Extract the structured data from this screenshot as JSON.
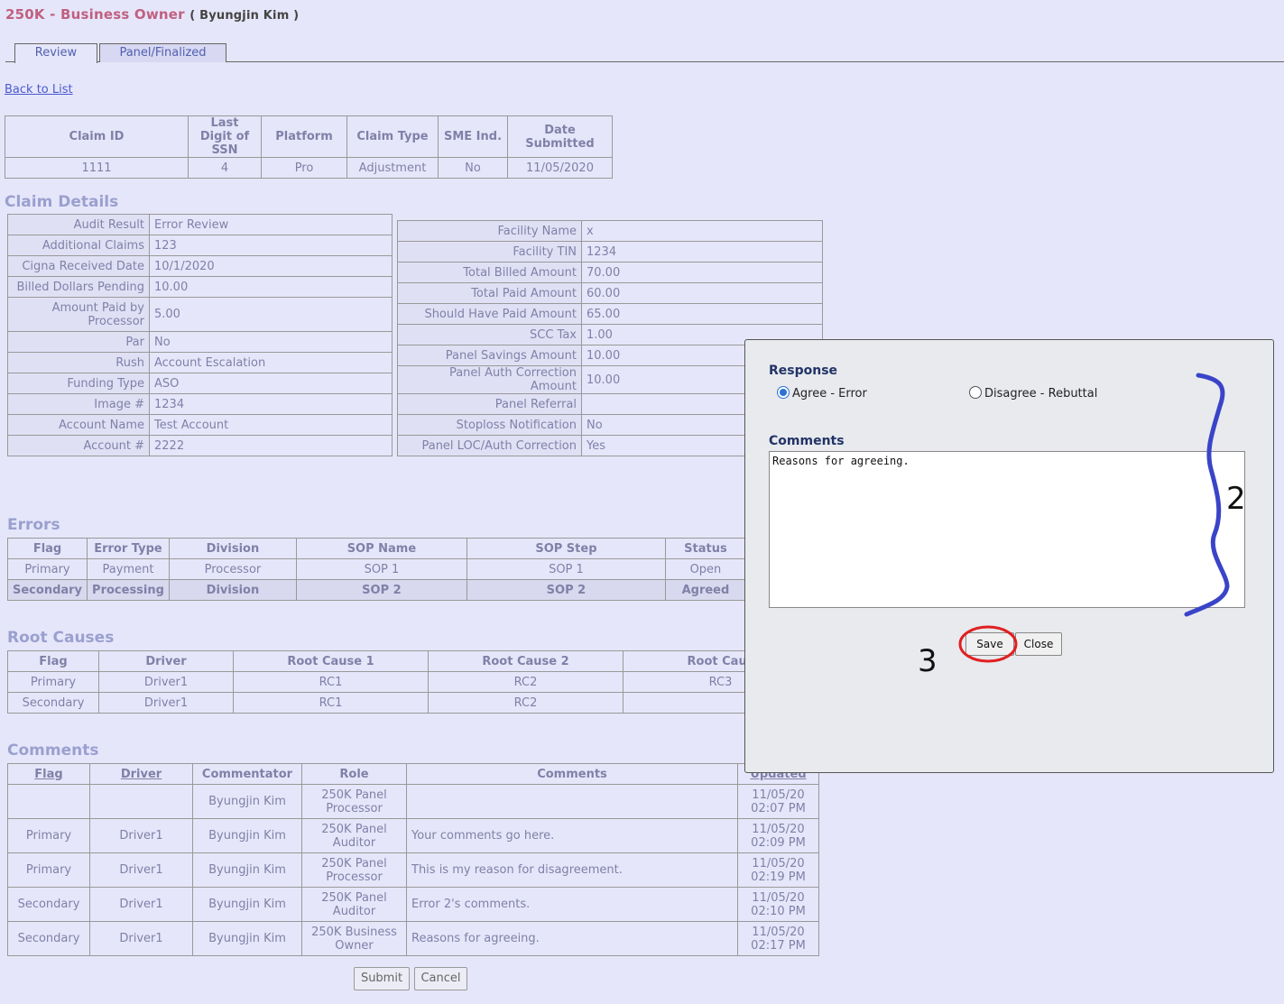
{
  "header": {
    "title": "250K - Business Owner",
    "user": "( Byungjin Kim )"
  },
  "tabs": [
    {
      "label": "Review"
    },
    {
      "label": "Panel/Finalized"
    }
  ],
  "back_link": "Back to List",
  "claim_summary": {
    "headers": [
      "Claim ID",
      "Last Digit of SSN",
      "Platform",
      "Claim Type",
      "SME Ind.",
      "Date Submitted"
    ],
    "values": [
      "1111",
      "4",
      "Pro",
      "Adjustment",
      "No",
      "11/05/2020"
    ]
  },
  "claim_details": {
    "title": "Claim Details",
    "left": [
      [
        "Audit Result",
        "Error Review"
      ],
      [
        "Additional Claims",
        "123"
      ],
      [
        "Cigna Received Date",
        "10/1/2020"
      ],
      [
        "Billed Dollars Pending",
        "10.00"
      ],
      [
        "Amount Paid by Processor",
        "5.00"
      ],
      [
        "Par",
        "No"
      ],
      [
        "Rush",
        "Account Escalation"
      ],
      [
        "Funding Type",
        "ASO"
      ],
      [
        "Image #",
        "1234"
      ],
      [
        "Account Name",
        "Test Account"
      ],
      [
        "Account #",
        "2222"
      ]
    ],
    "right": [
      [
        "Facility Name",
        "x"
      ],
      [
        "Facility TIN",
        "1234"
      ],
      [
        "Total Billed Amount",
        "70.00"
      ],
      [
        "Total Paid Amount",
        "60.00"
      ],
      [
        "Should Have Paid Amount",
        "65.00"
      ],
      [
        "SCC Tax",
        "1.00"
      ],
      [
        "Panel Savings Amount",
        "10.00"
      ],
      [
        "Panel Auth Correction Amount",
        "10.00"
      ],
      [
        "Panel Referral",
        ""
      ],
      [
        "Stoploss Notification",
        "No"
      ],
      [
        "Panel LOC/Auth Correction",
        "Yes"
      ]
    ]
  },
  "errors": {
    "title": "Errors",
    "headers": [
      "Flag",
      "Error Type",
      "Division",
      "SOP Name",
      "SOP Step",
      "Status"
    ],
    "rows": [
      [
        "Primary",
        "Payment",
        "Processor",
        "SOP 1",
        "SOP 1",
        "Open"
      ],
      [
        "Secondary",
        "Processing",
        "Division",
        "SOP 2",
        "SOP 2",
        "Agreed"
      ]
    ]
  },
  "root_causes": {
    "title": "Root Causes",
    "headers": [
      "Flag",
      "Driver",
      "Root Cause 1",
      "Root Cause 2",
      "Root Caus"
    ],
    "rows": [
      [
        "Primary",
        "Driver1",
        "RC1",
        "RC2",
        "RC3"
      ],
      [
        "Secondary",
        "Driver1",
        "RC1",
        "RC2",
        ""
      ]
    ]
  },
  "comments": {
    "title": "Comments",
    "headers": [
      "Flag",
      "Driver",
      "Commentator",
      "Role",
      "Comments",
      "Updated"
    ],
    "rows": [
      [
        "",
        "",
        "Byungjin Kim",
        "250K Panel Processor",
        "",
        "11/05/20 02:07 PM"
      ],
      [
        "Primary",
        "Driver1",
        "Byungjin Kim",
        "250K Panel Auditor",
        "Your comments go here.",
        "11/05/20 02:09 PM"
      ],
      [
        "Primary",
        "Driver1",
        "Byungjin Kim",
        "250K Panel Processor",
        "This is my reason for disagreement.",
        "11/05/20 02:19 PM"
      ],
      [
        "Secondary",
        "Driver1",
        "Byungjin Kim",
        "250K Panel Auditor",
        "Error 2's comments.",
        "11/05/20 02:10 PM"
      ],
      [
        "Secondary",
        "Driver1",
        "Byungjin Kim",
        "250K Business Owner",
        "Reasons for agreeing.",
        "11/05/20 02:17 PM"
      ]
    ]
  },
  "actions": {
    "submit": "Submit",
    "cancel": "Cancel"
  },
  "modal": {
    "response_label": "Response",
    "option_agree": "Agree - Error",
    "option_disagree": "Disagree - Rebuttal",
    "selected": "agree",
    "comments_label": "Comments",
    "comment_value": "Reasons for agreeing.",
    "save": "Save",
    "close": "Close"
  },
  "annotations": {
    "brace_number": "2",
    "save_number": "3",
    "brace_color": "#3a44c8",
    "circle_color": "#e02020"
  }
}
